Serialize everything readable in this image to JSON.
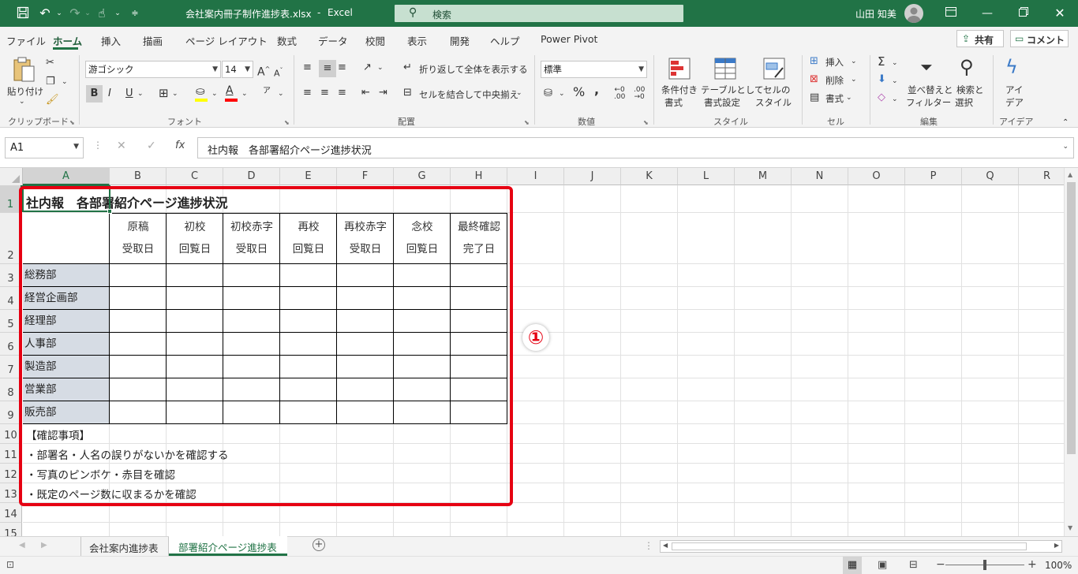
{
  "titlebar": {
    "file_name": "会社案内冊子制作進捗表.xlsx",
    "separator": "-",
    "app_name": "Excel",
    "search_placeholder": "検索",
    "user_name": "山田 知美"
  },
  "menu_tabs": [
    "ファイル",
    "ホーム",
    "挿入",
    "描画",
    "ページ レイアウト",
    "数式",
    "データ",
    "校閲",
    "表示",
    "開発",
    "ヘルプ",
    "Power Pivot"
  ],
  "share": {
    "share_label": "共有",
    "comment_label": "コメント"
  },
  "ribbon": {
    "clipboard": {
      "paste_label": "貼り付け",
      "group_label": "クリップボード"
    },
    "font": {
      "font_name": "游ゴシック",
      "font_size": "14",
      "bold": "B",
      "italic": "I",
      "underline": "U",
      "grow": "A",
      "shrink": "A",
      "group_label": "フォント",
      "phonetic": "ア"
    },
    "alignment": {
      "wrap_label": "折り返して全体を表示する",
      "merge_label": "セルを結合して中央揃え",
      "group_label": "配置"
    },
    "number": {
      "format": "標準",
      "percent": "%",
      "comma": ",",
      "group_label": "数値"
    },
    "styles": {
      "conditional_label": "条件付き\n書式",
      "conditional_l1": "条件付き",
      "conditional_l2": "書式",
      "table_l1": "テーブルとして",
      "table_l2": "書式設定",
      "cell_l1": "セルの",
      "cell_l2": "スタイル",
      "group_label": "スタイル"
    },
    "cells": {
      "insert": "挿入",
      "delete": "削除",
      "format": "書式",
      "group_label": "セル"
    },
    "editing": {
      "sort_l1": "並べ替えと",
      "sort_l2": "フィルター",
      "find_l1": "検索と",
      "find_l2": "選択",
      "group_label": "編集"
    },
    "ideas": {
      "l1": "アイ",
      "l2": "デア",
      "group_label": "アイデア"
    }
  },
  "formula_bar": {
    "name_box": "A1",
    "fx": "fx",
    "content": "社内報　各部署紹介ページ進捗状況"
  },
  "columns": [
    "A",
    "B",
    "C",
    "D",
    "E",
    "F",
    "G",
    "H",
    "I",
    "J",
    "K",
    "L",
    "M",
    "N",
    "O",
    "P",
    "Q",
    "R"
  ],
  "rows": [
    "1",
    "2",
    "3",
    "4",
    "5",
    "6",
    "7",
    "8",
    "9",
    "10",
    "11",
    "12",
    "13",
    "14",
    "15"
  ],
  "sheet": {
    "title": "社内報　各部署紹介ページ進捗状況",
    "headers": [
      {
        "l1": "原稿",
        "l2": "受取日"
      },
      {
        "l1": "初校",
        "l2": "回覧日"
      },
      {
        "l1": "初校赤字",
        "l2": "受取日"
      },
      {
        "l1": "再校",
        "l2": "回覧日"
      },
      {
        "l1": "再校赤字",
        "l2": "受取日"
      },
      {
        "l1": "念校",
        "l2": "回覧日"
      },
      {
        "l1": "最終確認",
        "l2": "完了日"
      }
    ],
    "departments": [
      "総務部",
      "経営企画部",
      "経理部",
      "人事部",
      "製造部",
      "営業部",
      "販売部"
    ],
    "notes_title": "【確認事項】",
    "notes": [
      "・部署名・人名の誤りがないかを確認する",
      "・写真のピンボケ・赤目を確認",
      "・既定のページ数に収まるかを確認"
    ]
  },
  "annotation": {
    "label": "①",
    "color": "#e60012"
  },
  "sheet_tabs": [
    {
      "label": "会社案内進捗表",
      "active": false
    },
    {
      "label": "部署紹介ページ進捗表",
      "active": true
    }
  ],
  "status": {
    "zoom": "100%",
    "zoom_minus": "−",
    "zoom_plus": "+"
  },
  "colors": {
    "excel_green": "#217346",
    "dept_fill": "#d6dce4",
    "highlight": "#e60012"
  }
}
